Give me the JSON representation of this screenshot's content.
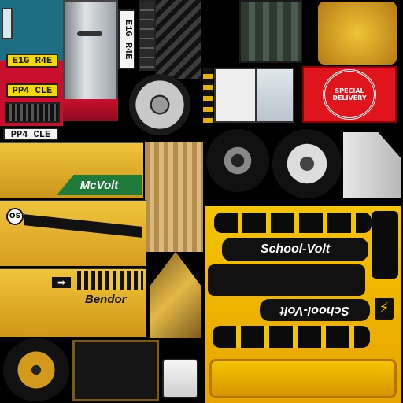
{
  "truck": {
    "plate_front": "E1G R4E",
    "plate_lower": "PP4 CLE",
    "plate_side": "PP4 CLE",
    "plate_vertical": "E1G R4E"
  },
  "van": {
    "badge_text": "SPECIAL DELIVERY"
  },
  "crane": {
    "brand": "McVolt",
    "sticker": "OS",
    "name": "Bendor"
  },
  "bus": {
    "brand_top": "School-Volt",
    "brand_bottom": "School-Volt"
  },
  "colors": {
    "truck_red": "#c8102e",
    "truck_teal": "#1d6e83",
    "school_yellow": "#f2b400",
    "crane_yellow": "#e3b320",
    "badge_red": "#e0141b",
    "mcvolt_green": "#1f7a3a"
  },
  "icons": [
    "wheel-icon",
    "arrow-icon",
    "lightning-icon",
    "grille-icon"
  ]
}
